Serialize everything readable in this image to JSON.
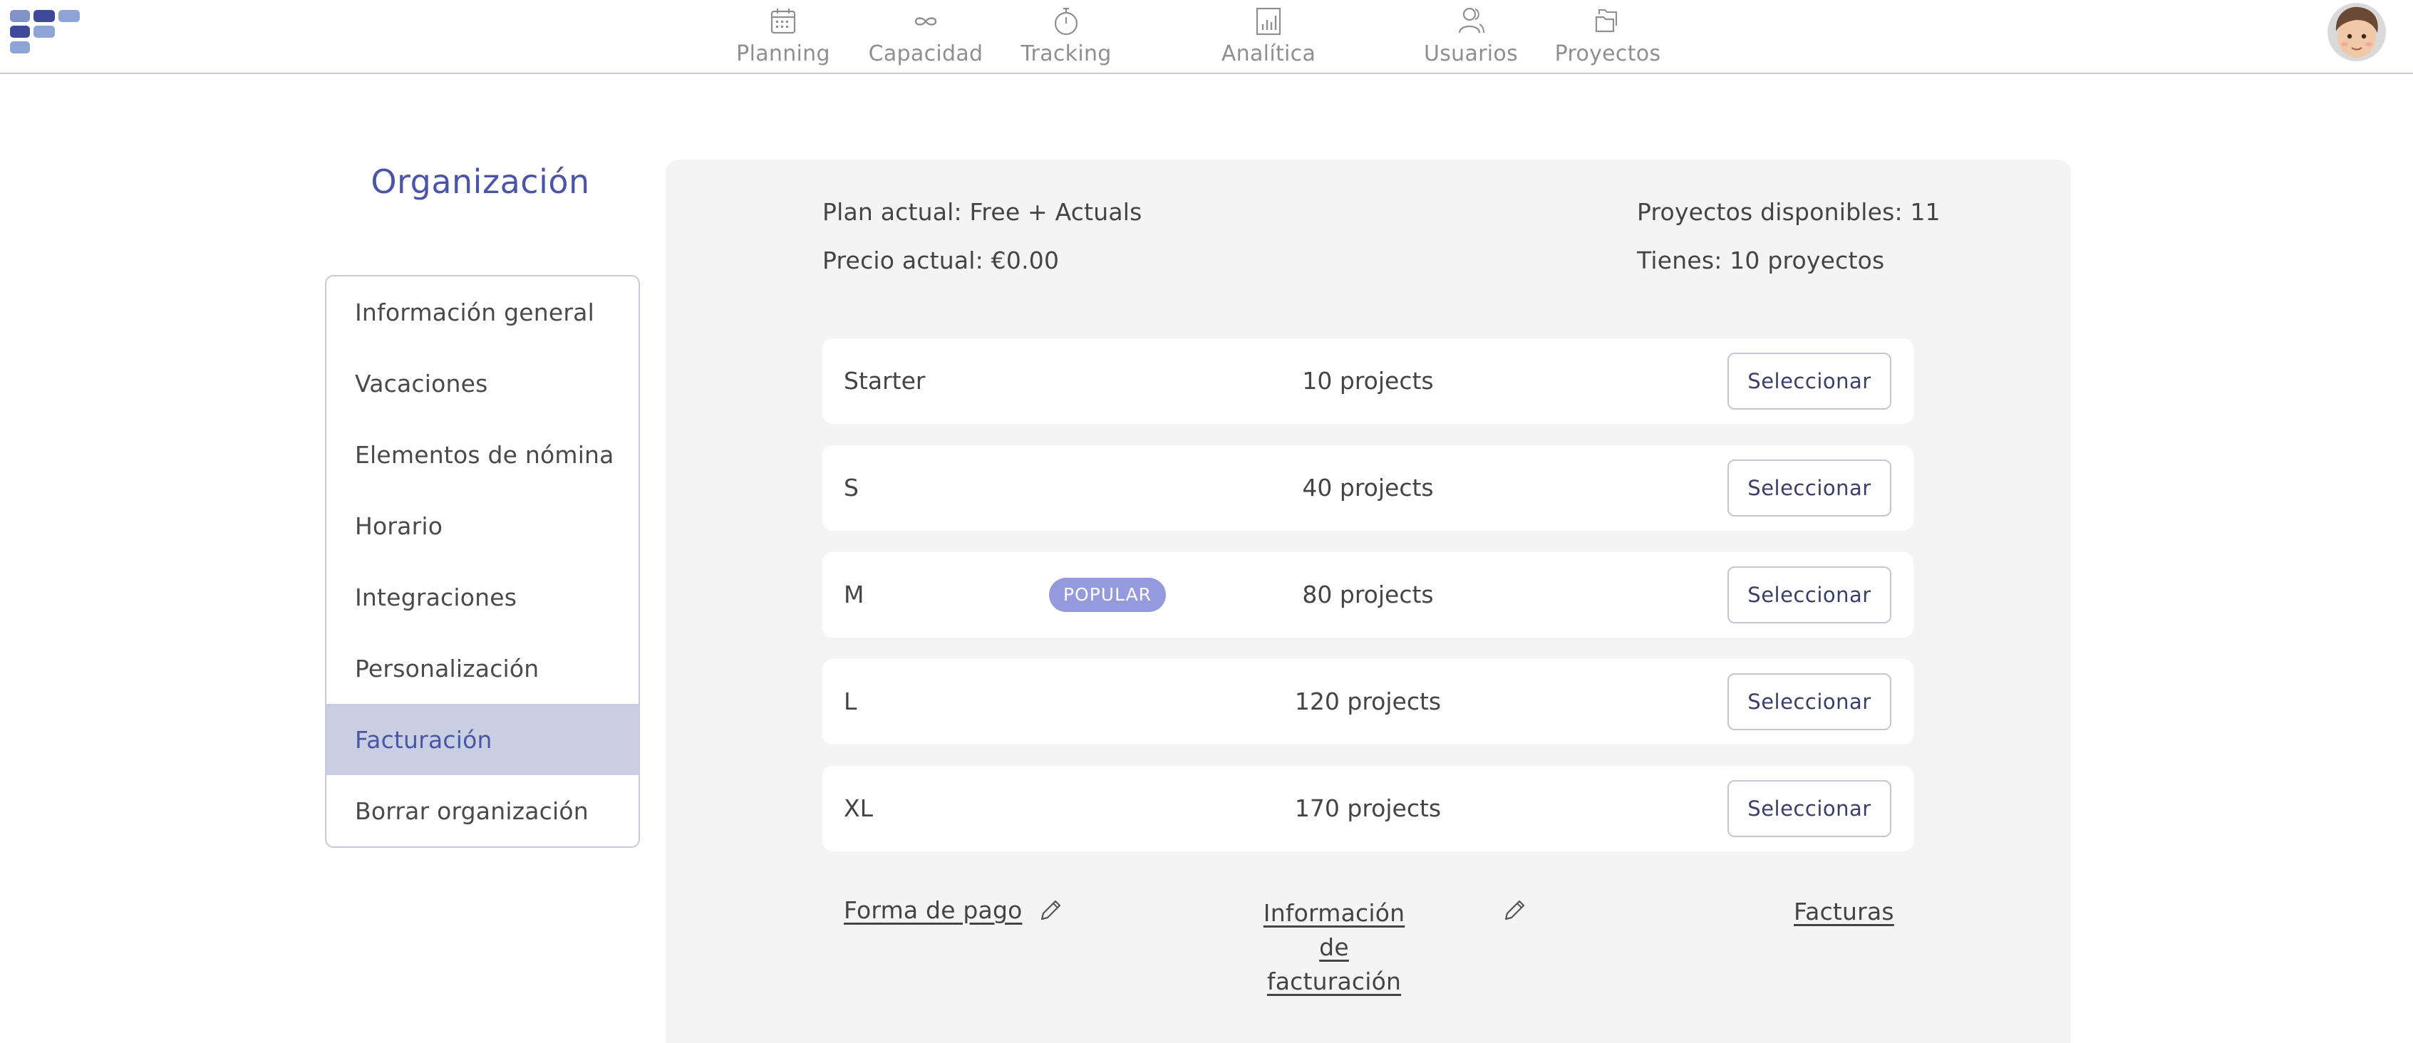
{
  "brand": {
    "logo_colors": [
      "#7f93c9",
      "#3f4a9a",
      "#8ea4d6"
    ]
  },
  "nav": {
    "items": [
      {
        "label": "Planning",
        "icon": "calendar-icon"
      },
      {
        "label": "Capacidad",
        "icon": "infinity-icon"
      },
      {
        "label": "Tracking",
        "icon": "stopwatch-icon"
      },
      {
        "label": "Analítica",
        "icon": "bar-chart-icon"
      },
      {
        "label": "Usuarios",
        "icon": "users-icon"
      },
      {
        "label": "Proyectos",
        "icon": "folders-icon"
      }
    ],
    "avatar_icon": "user-avatar"
  },
  "sidebar": {
    "title": "Organización",
    "items": [
      {
        "label": "Información general"
      },
      {
        "label": "Vacaciones"
      },
      {
        "label": "Elementos de nómina"
      },
      {
        "label": "Horario"
      },
      {
        "label": "Integraciones"
      },
      {
        "label": "Personalización"
      },
      {
        "label": "Facturación",
        "active": true
      },
      {
        "label": "Borrar organización"
      }
    ]
  },
  "billing": {
    "plan_actual": "Plan actual: Free + Actuals",
    "precio_actual": "Precio actual: €0.00",
    "proyectos_disponibles": "Proyectos disponibles: 11",
    "tienes": "Tienes: 10 proyectos",
    "plans": [
      {
        "name": "Starter",
        "projects": "10 projects",
        "button": "Seleccionar"
      },
      {
        "name": "S",
        "projects": "40 projects",
        "button": "Seleccionar"
      },
      {
        "name": "M",
        "badge": "POPULAR",
        "projects": "80 projects",
        "button": "Seleccionar"
      },
      {
        "name": "L",
        "projects": "120 projects",
        "button": "Seleccionar"
      },
      {
        "name": "XL",
        "projects": "170 projects",
        "button": "Seleccionar"
      }
    ],
    "links": {
      "forma_de_pago": "Forma de pago",
      "informacion_line1": "Información de",
      "informacion_line2": "facturación",
      "facturas": "Facturas"
    },
    "accent_color": "#4b55a8",
    "badge_color": "#9599dd",
    "active_bg": "#c8cfe3"
  }
}
